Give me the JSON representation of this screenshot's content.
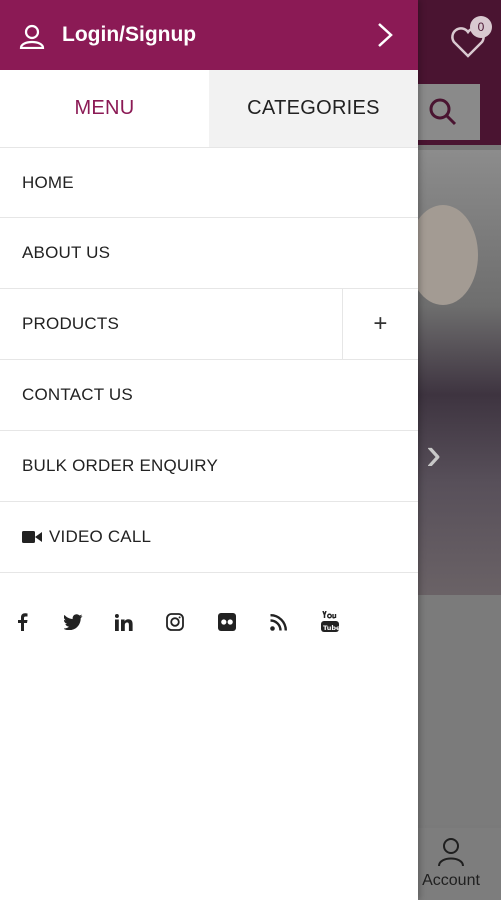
{
  "drawer": {
    "login_label": "Login/Signup",
    "tabs": [
      {
        "label": "MENU",
        "active": true
      },
      {
        "label": "CATEGORIES",
        "active": false
      }
    ],
    "menu_items": [
      {
        "label": "HOME"
      },
      {
        "label": "ABOUT US"
      },
      {
        "label": "PRODUCTS",
        "expandable": true,
        "expand_glyph": "+"
      },
      {
        "label": "CONTACT US"
      },
      {
        "label": "BULK ORDER ENQUIRY"
      },
      {
        "label": "VIDEO CALL",
        "icon": "video-camera-icon"
      }
    ],
    "social_icons": [
      "facebook-icon",
      "twitter-icon",
      "linkedin-icon",
      "instagram-icon",
      "flickr-icon",
      "rss-icon",
      "youtube-icon"
    ]
  },
  "background": {
    "wishlist_count": "0",
    "tabbar_account_label": "Account"
  },
  "colors": {
    "brand": "#8b1a55",
    "tab_inactive_bg": "#f2f2f2"
  }
}
